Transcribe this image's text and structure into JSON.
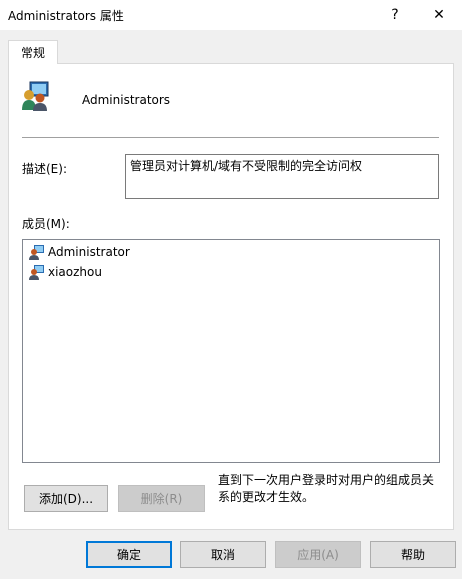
{
  "window": {
    "title": "Administrators 属性",
    "help_glyph": "?",
    "close_glyph": "✕"
  },
  "tabs": [
    {
      "label": "常规"
    }
  ],
  "group": {
    "name": "Administrators",
    "icon": "group-users-icon"
  },
  "description": {
    "label": "描述(E):",
    "value": "管理员对计算机/域有不受限制的完全访问权"
  },
  "members": {
    "label": "成员(M):",
    "items": [
      {
        "name": "Administrator",
        "icon": "user-icon"
      },
      {
        "name": "xiaozhou",
        "icon": "user-icon"
      }
    ]
  },
  "buttons": {
    "add": "添加(D)...",
    "remove": "删除(R)",
    "ok": "确定",
    "cancel": "取消",
    "apply": "应用(A)",
    "help": "帮助"
  },
  "note": "直到下一次用户登录时对用户的组成员关系的更改才生效。",
  "colors": {
    "accent": "#0078d7",
    "dialog_bg": "#f0f0f0",
    "disabled_text": "#8d8d8d"
  }
}
